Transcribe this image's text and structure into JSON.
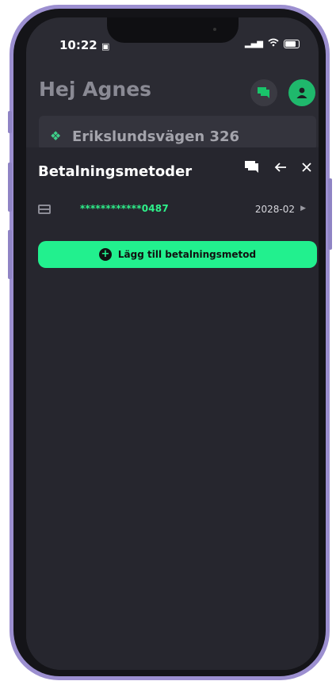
{
  "status_bar": {
    "time": "10:22",
    "signal": "▂▄▆",
    "wifi": "◠"
  },
  "home": {
    "greeting": "Hej Agnes",
    "address": "Erikslundsvägen 326"
  },
  "sheet": {
    "title": "Betalningsmetoder",
    "card": {
      "number": "************0487",
      "expiry": "2028-02"
    },
    "add_button_label": "Lägg till betalningsmetod"
  },
  "colors": {
    "accent": "#22f08e",
    "background": "#26262e",
    "frame": "#9c8fd0"
  },
  "icons": [
    "chat-icon",
    "user-icon",
    "back-arrow-icon",
    "close-icon",
    "credit-card-icon",
    "chevron-right-icon",
    "plus-circle-icon",
    "battery-icon",
    "wifi-icon",
    "signal-icon"
  ]
}
